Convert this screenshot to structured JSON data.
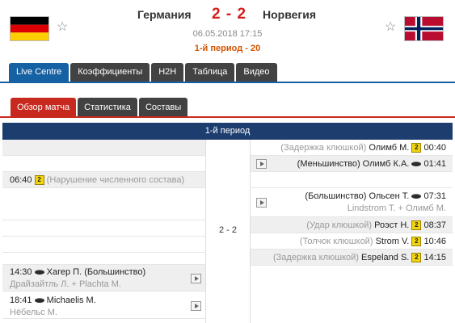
{
  "match": {
    "home_team": "Германия",
    "away_team": "Норвегия",
    "score": "2 - 2",
    "date": "06.05.2018 17:15",
    "status": "1-й период - 20",
    "home_flag_colors": [
      "#000000",
      "#dd0000",
      "#ffce00"
    ],
    "away_flag_colors": {
      "field": "#ba0c2f",
      "cross_outer": "#ffffff",
      "cross_inner": "#00205b"
    }
  },
  "tabs": {
    "main": [
      "Live Centre",
      "Коэффициенты",
      "H2H",
      "Таблица",
      "Видео"
    ],
    "main_active": 0,
    "sub": [
      "Обзор матча",
      "Статистика",
      "Составы"
    ],
    "sub_active": 0
  },
  "period": {
    "label": "1-й период",
    "score": "2 - 2"
  },
  "events": {
    "home": [
      {
        "time": "06:40",
        "type": "card",
        "card_value": "2",
        "detail": "(Нарушение численного состава)"
      },
      {
        "time": "14:30",
        "type": "goal",
        "player": "Хагер П. (Большинство)",
        "assist": "Драйзайтль Л. + Plachta M."
      },
      {
        "time": "18:41",
        "type": "goal",
        "player": "Michaelis M.",
        "assist": "Нёбельс М."
      }
    ],
    "away": [
      {
        "time": "00:40",
        "type": "card",
        "card_value": "2",
        "detail": "(Задержка клюшкой)",
        "player": "Олимб М."
      },
      {
        "time": "01:41",
        "type": "goal",
        "player": "(Меньшинство) Олимб К.А."
      },
      {
        "time": "07:31",
        "type": "goal",
        "player": "(Большинство) Ольсен Т.",
        "assist": "Lindstrom T. + Олимб М."
      },
      {
        "time": "08:37",
        "type": "card",
        "card_value": "2",
        "detail": "(Удар клюшкой)",
        "player": "Роэст Н."
      },
      {
        "time": "10:46",
        "type": "card",
        "card_value": "2",
        "detail": "(Толчок клюшкой)",
        "player": "Strom V."
      },
      {
        "time": "14:15",
        "type": "card",
        "card_value": "2",
        "detail": "(Задержка клюшкой)",
        "player": "Espeland S."
      }
    ]
  }
}
